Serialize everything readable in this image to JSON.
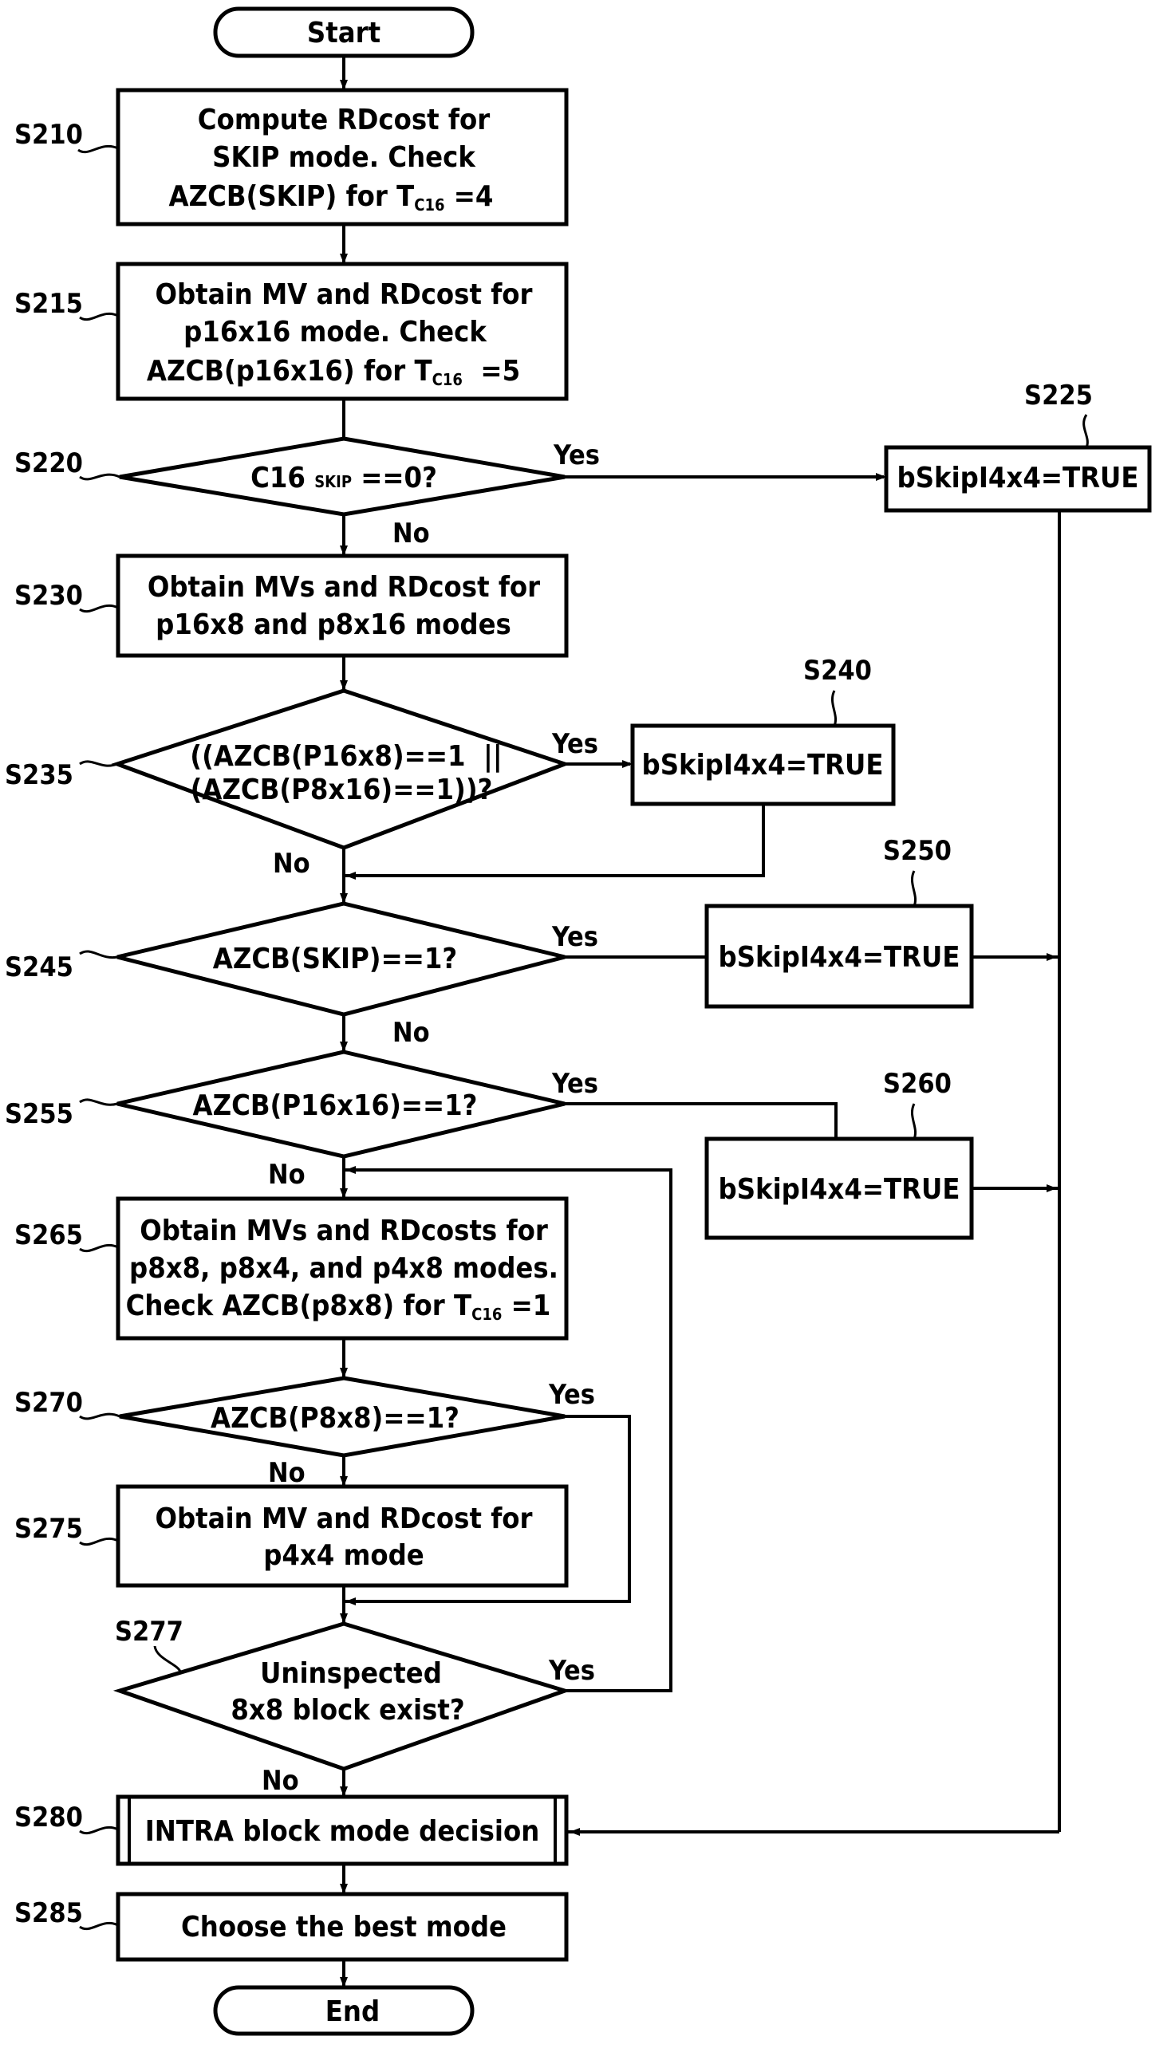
{
  "figure": {
    "type": "flowchart",
    "colors": {
      "stroke": "#000000",
      "background": "#ffffff"
    }
  },
  "terminals": {
    "start": "Start",
    "end": "End"
  },
  "steps": {
    "S210": {
      "id": "S210",
      "lines": [
        "Compute RDcost for",
        "SKIP mode. Check",
        "AZCB(SKIP) for T"
      ],
      "sub": "C16",
      "suffix": " =4"
    },
    "S215": {
      "id": "S215",
      "lines": [
        "Obtain MV and RDcost for",
        "p16x16 mode. Check",
        "AZCB(p16x16) for T"
      ],
      "sub": "C16",
      "suffix": "  =5"
    },
    "S220": {
      "id": "S220",
      "text_pre": "C16 ",
      "sub": "SKIP",
      "text_post": " ==0?"
    },
    "S225": {
      "id": "S225",
      "text": "bSkipI4x4=TRUE"
    },
    "S230": {
      "id": "S230",
      "lines": [
        "Obtain MVs and RDcost for",
        "p16x8 and p8x16 modes"
      ]
    },
    "S235": {
      "id": "S235",
      "lines": [
        "((AZCB(P16x8)==1  ||",
        "(AZCB(P8x16)==1))?"
      ]
    },
    "S240": {
      "id": "S240",
      "text": "bSkipI4x4=TRUE"
    },
    "S245": {
      "id": "S245",
      "text": "AZCB(SKIP)==1?"
    },
    "S250": {
      "id": "S250",
      "text": "bSkipI4x4=TRUE"
    },
    "S255": {
      "id": "S255",
      "text": "AZCB(P16x16)==1?"
    },
    "S260": {
      "id": "S260",
      "text": "bSkipI4x4=TRUE"
    },
    "S265": {
      "id": "S265",
      "lines": [
        "Obtain MVs and RDcosts for",
        "p8x8, p8x4, and p4x8 modes.",
        "Check AZCB(p8x8) for T"
      ],
      "sub": "C16",
      "suffix": " =1"
    },
    "S270": {
      "id": "S270",
      "text": "AZCB(P8x8)==1?"
    },
    "S275": {
      "id": "S275",
      "lines": [
        "Obtain MV and RDcost for",
        "p4x4 mode"
      ]
    },
    "S277": {
      "id": "S277",
      "lines": [
        "Uninspected",
        "8x8 block exist?"
      ]
    },
    "S280": {
      "id": "S280",
      "text": "INTRA block mode decision"
    },
    "S285": {
      "id": "S285",
      "text": "Choose the best mode"
    }
  },
  "branches": {
    "yes": "Yes",
    "no": "No"
  }
}
